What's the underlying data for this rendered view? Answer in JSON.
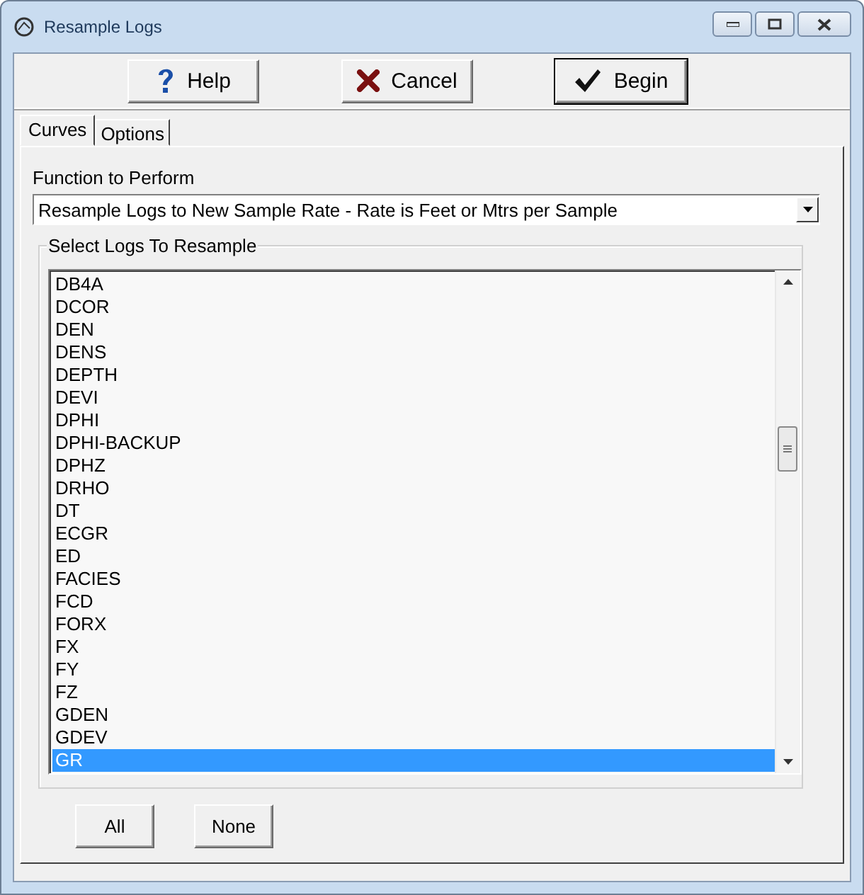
{
  "window": {
    "title": "Resample Logs"
  },
  "toolbar": [
    {
      "kind": "help",
      "label": "Help"
    },
    {
      "kind": "cancel",
      "label": "Cancel"
    },
    {
      "kind": "begin",
      "label": "Begin"
    }
  ],
  "tabs": [
    {
      "label": "Curves",
      "selected": true
    },
    {
      "label": "Options",
      "selected": false
    }
  ],
  "function": {
    "label": "Function to Perform",
    "value": "Resample Logs to New Sample Rate - Rate is Feet or Mtrs per Sample"
  },
  "logs": {
    "title": "Select Logs To Resample",
    "items": [
      {
        "label": "DB4A",
        "selected": false
      },
      {
        "label": "DCOR",
        "selected": false
      },
      {
        "label": "DEN",
        "selected": false
      },
      {
        "label": "DENS",
        "selected": false
      },
      {
        "label": "DEPTH",
        "selected": false
      },
      {
        "label": "DEVI",
        "selected": false
      },
      {
        "label": "DPHI",
        "selected": false
      },
      {
        "label": "DPHI-BACKUP",
        "selected": false
      },
      {
        "label": "DPHZ",
        "selected": false
      },
      {
        "label": "DRHO",
        "selected": false
      },
      {
        "label": "DT",
        "selected": false
      },
      {
        "label": "ECGR",
        "selected": false
      },
      {
        "label": "ED",
        "selected": false
      },
      {
        "label": "FACIES",
        "selected": false
      },
      {
        "label": "FCD",
        "selected": false
      },
      {
        "label": "FORX",
        "selected": false
      },
      {
        "label": "FX",
        "selected": false
      },
      {
        "label": "FY",
        "selected": false
      },
      {
        "label": "FZ",
        "selected": false
      },
      {
        "label": "GDEN",
        "selected": false
      },
      {
        "label": "GDEV",
        "selected": false
      },
      {
        "label": "GR",
        "selected": true
      }
    ],
    "buttons": [
      "All",
      "None"
    ]
  }
}
